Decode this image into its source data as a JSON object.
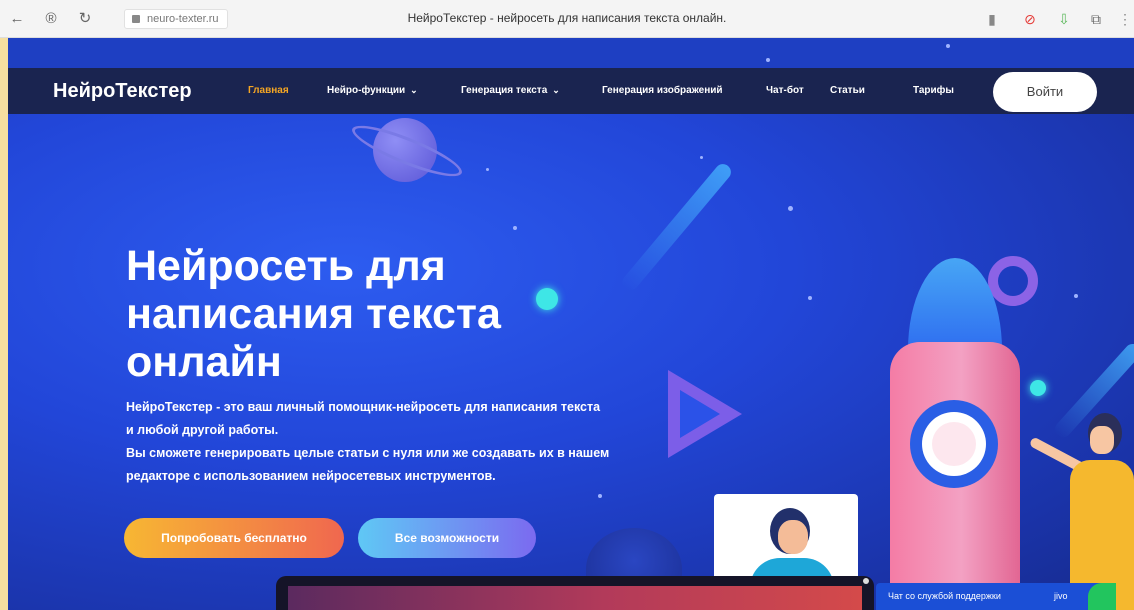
{
  "browser": {
    "url": "neuro-texter.ru",
    "title": "НейроТекстер - нейросеть для написания текста онлайн."
  },
  "site": {
    "logo": "НейроТекстер",
    "nav": [
      {
        "label": "Главная",
        "active": true,
        "dropdown": false
      },
      {
        "label": "Нейро-функции",
        "active": false,
        "dropdown": true
      },
      {
        "label": "Генерация текста",
        "active": false,
        "dropdown": true
      },
      {
        "label": "Генерация изображений",
        "active": false,
        "dropdown": false
      },
      {
        "label": "Чат-бот",
        "active": false,
        "dropdown": false
      },
      {
        "label": "Статьи",
        "active": false,
        "dropdown": false
      },
      {
        "label": "Тарифы",
        "active": false,
        "dropdown": false
      }
    ],
    "login_label": "Войти"
  },
  "hero": {
    "title_line1": "Нейросеть для",
    "title_line2": "написания текста",
    "title_line3": "онлайн",
    "text_line1": "НейроТекстер - это ваш личный помощник-нейросеть для написания текста",
    "text_line2": "и любой другой работы.",
    "text_line3": "Вы сможете генерировать целые статьи с нуля или же создавать их в нашем",
    "text_line4": "редакторе с использованием нейросетевых инструментов.",
    "btn_try": "Попробовать бесплатно",
    "btn_all": "Все возможности"
  },
  "chat": {
    "label": "Чат со службой поддержки",
    "brand": "jivo"
  },
  "colors": {
    "accent_active": "#f5a623",
    "navbar_bg": "#1a2450",
    "hero_bg": "#2246d8"
  }
}
